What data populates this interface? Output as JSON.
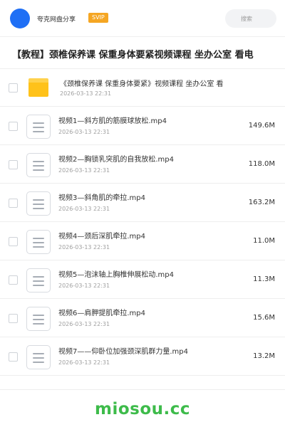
{
  "header": {
    "username": "夸克网盘分享",
    "badge": "SVIP",
    "search_placeholder": "搜索",
    "accent_color": "#1f6ff5",
    "badge_color": "#f5a623"
  },
  "page": {
    "title": "【教程】颈椎保养课 保重身体要紧视频课程 坐办公室 看电"
  },
  "folder": {
    "icon": "folder-icon",
    "name": "《颈椎保养课 保重身体要紧》视频课程 坐办公室 看",
    "date": "2026-03-13 22:31"
  },
  "files": [
    {
      "name": "视频1—斜方肌的筋膜球放松.mp4",
      "date": "2026-03-13 22:31",
      "size": "149.6M",
      "icon": "video-file-icon"
    },
    {
      "name": "视频2—胸锁乳突肌的自我放松.mp4",
      "date": "2026-03-13 22:31",
      "size": "118.0M",
      "icon": "video-file-icon"
    },
    {
      "name": "视频3—斜角肌的牵拉.mp4",
      "date": "2026-03-13 22:31",
      "size": "163.2M",
      "icon": "video-file-icon"
    },
    {
      "name": "视频4—颈后深肌牵拉.mp4",
      "date": "2026-03-13 22:31",
      "size": "11.0M",
      "icon": "video-file-icon"
    },
    {
      "name": "视频5—泡沫轴上胸椎伸展松动.mp4",
      "date": "2026-03-13 22:31",
      "size": "11.3M",
      "icon": "video-file-icon"
    },
    {
      "name": "视频6—肩胛提肌牵拉.mp4",
      "date": "2026-03-13 22:31",
      "size": "15.6M",
      "icon": "video-file-icon"
    },
    {
      "name": "视频7——仰卧位加强颈深肌群力量.mp4",
      "date": "2026-03-13 22:31",
      "size": "13.2M",
      "icon": "video-file-icon"
    }
  ],
  "watermark": {
    "text": "miosou.cc",
    "color": "#3dbb4a"
  }
}
